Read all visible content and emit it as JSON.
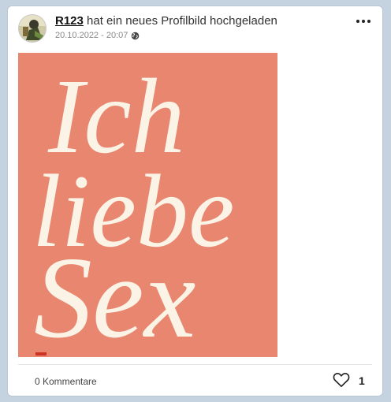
{
  "post": {
    "username": "R123",
    "action_text": " hat ein neues Profilbild hochgeladen",
    "date": "20.10.2022 - 20:07",
    "visibility_icon": "globe-icon",
    "menu_icon": "more-dots-icon"
  },
  "image": {
    "lines": [
      "Ich",
      "liebe",
      "Sex"
    ],
    "background_color": "#e98670",
    "text_color": "#fbf3e6"
  },
  "footer": {
    "comments_label": "0 Kommentare",
    "like_icon": "heart-icon",
    "like_count": "1"
  }
}
